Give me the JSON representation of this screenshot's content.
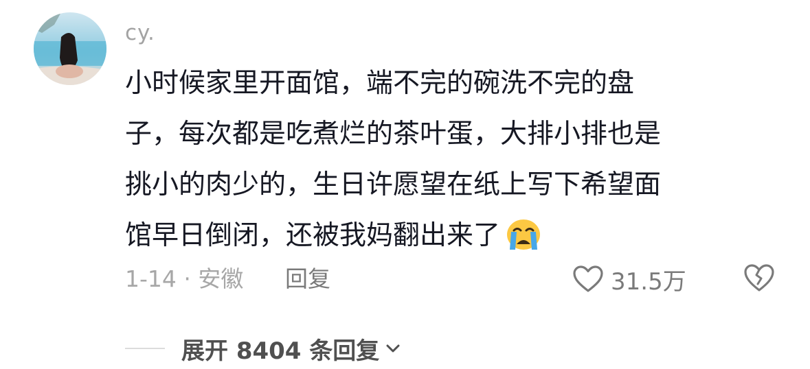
{
  "comment": {
    "username": "cy.",
    "text_lines": [
      "小时候家里开面馆，端不完的碗洗不完的盘",
      "子，每次都是吃煮烂的茶叶蛋，大排小排也是",
      "挑小的肉少的，生日许愿望在纸上写下希望面",
      "馆早日倒闭，还被我妈翻出来了"
    ],
    "emoji": "loudly-crying-face-emoji",
    "meta": "1-14 · 安徽",
    "reply_label": "回复",
    "like_count": "31.5万",
    "expand_label": "展开 8404 条回复"
  },
  "icons": {
    "like": "heart-icon",
    "dislike": "broken-heart-icon",
    "expand": "chevron-down-icon"
  },
  "colors": {
    "text_primary": "#161823",
    "text_muted": "#a3a3a3",
    "action_gray": "#7a7a7a"
  }
}
